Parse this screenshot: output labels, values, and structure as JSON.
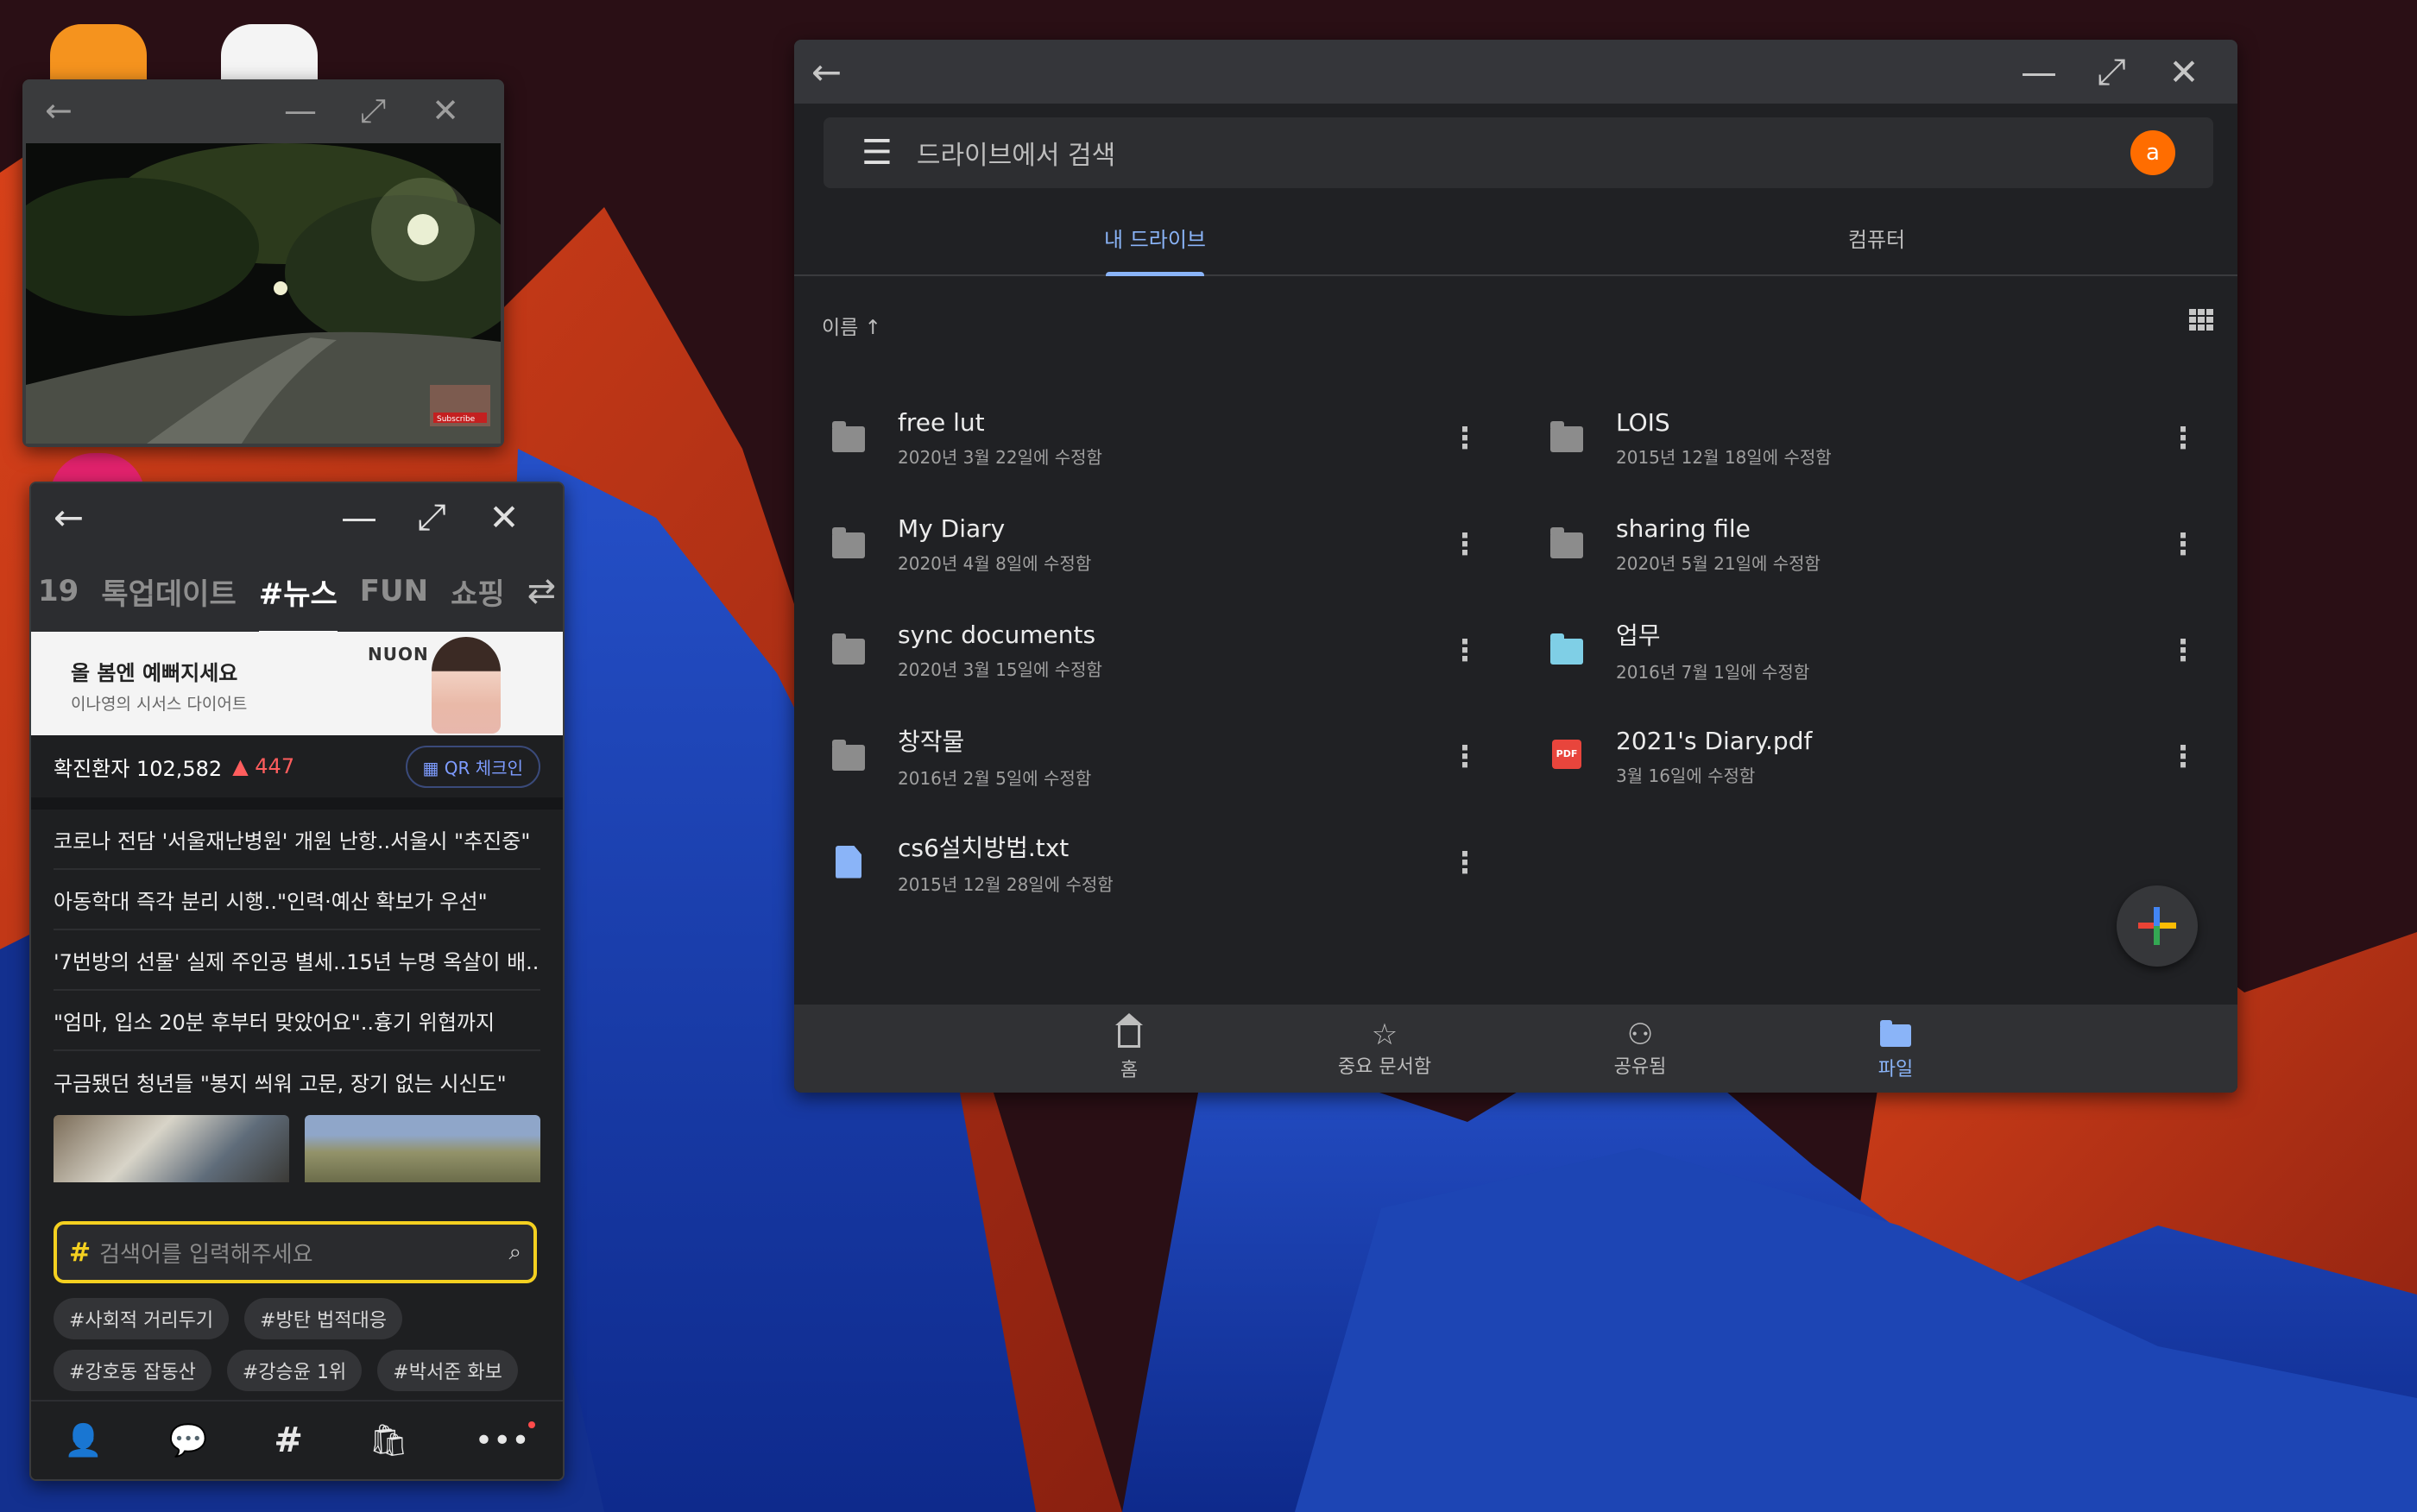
{
  "video_window": {
    "controls": {
      "back": "←",
      "minimize": "—",
      "maximize": "⤢",
      "close": "✕"
    },
    "subscribe_label": "Subscribe"
  },
  "news_window": {
    "controls": {
      "back": "←",
      "minimize": "—",
      "maximize": "⤢",
      "close": "✕"
    },
    "tabs": [
      "19",
      "톡업데이트",
      "#뉴스",
      "FUN",
      "쇼핑"
    ],
    "active_tab": "#뉴스",
    "banner": {
      "title": "올 봄엔 예뻐지세요",
      "subtitle": "이나영의 시서스 다이어트",
      "brand": "NUON"
    },
    "covid": {
      "label": "확진환자 102,582",
      "change": "▲ 447",
      "qr_button": "QR 체크인"
    },
    "headlines": [
      "코로나 전담 '서울재난병원' 개원 난항..서울시 \"추진중\"",
      "아동학대 즉각 분리 시행..\"인력·예산 확보가 우선\"",
      "'7번방의 선물' 실제 주인공 별세..15년 누명 옥살이 배...",
      "\"엄마, 입소 20분 후부터 맞았어요\"..흉기 위협까지",
      "구금됐던 청년들 \"봉지 씌워 고문, 장기 없는 시신도\""
    ],
    "search": {
      "prefix": "#",
      "placeholder": "검색어를 입력해주세요"
    },
    "tags": [
      "#사회적 거리두기",
      "#방탄 법적대응",
      "#강호동 잡동산",
      "#강승윤 1위",
      "#박서준 화보"
    ],
    "nav": {
      "friends": "👤",
      "chat": "💬",
      "hash": "#",
      "shop": "🛍",
      "more": "•••"
    }
  },
  "drive_window": {
    "controls": {
      "back": "←",
      "minimize": "—",
      "maximize": "⤢",
      "close": "✕"
    },
    "search_placeholder": "드라이브에서 검색",
    "avatar_letter": "a",
    "tabs": {
      "my_drive": "내 드라이브",
      "computers": "컴퓨터"
    },
    "sort_label": "이름 ↑",
    "files": [
      {
        "name": "free lut",
        "meta": "2020년 3월 22일에 수정함",
        "type": "folder"
      },
      {
        "name": "LOIS",
        "meta": "2015년 12월 18일에 수정함",
        "type": "folder"
      },
      {
        "name": "My Diary",
        "meta": "2020년 4월 8일에 수정함",
        "type": "folder"
      },
      {
        "name": "sharing file",
        "meta": "2020년 5월 21일에 수정함",
        "type": "folder"
      },
      {
        "name": "sync documents",
        "meta": "2020년 3월 15일에 수정함",
        "type": "folder"
      },
      {
        "name": "업무",
        "meta": "2016년 7월 1일에 수정함",
        "type": "folder-blue"
      },
      {
        "name": "창작물",
        "meta": "2016년 2월 5일에 수정함",
        "type": "folder"
      },
      {
        "name": "2021's Diary.pdf",
        "meta": "3월 16일에 수정함",
        "type": "pdf"
      },
      {
        "name": "cs6설치방법.txt",
        "meta": "2015년 12월 28일에 수정함",
        "type": "doc"
      }
    ],
    "pdf_badge": "PDF",
    "nav": [
      {
        "label": "홈",
        "icon": "home-icon"
      },
      {
        "label": "중요 문서함",
        "icon": "star-icon"
      },
      {
        "label": "공유됨",
        "icon": "people-icon"
      },
      {
        "label": "파일",
        "icon": "folder-icon"
      }
    ],
    "colors": {
      "accent": "#8ab4f8",
      "avatar": "#ff6d00"
    }
  }
}
